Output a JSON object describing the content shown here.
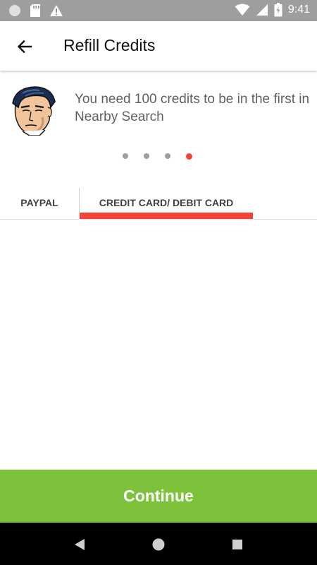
{
  "status_bar": {
    "time": "9:41",
    "icons": [
      "circle-icon",
      "sd-card-icon",
      "warning-icon",
      "wifi-icon",
      "signal-icon",
      "battery-icon"
    ]
  },
  "app_bar": {
    "title": "Refill Credits",
    "back_icon": "arrow-left-icon"
  },
  "banner": {
    "message": "You need 100 credits to be in the first in Nearby Search",
    "page_indicator": {
      "count": 4,
      "active_index": 3
    }
  },
  "tabs": [
    {
      "label": "PAYPAL",
      "selected": false
    },
    {
      "label": "CREDIT CARD/ DEBIT CARD",
      "selected": true
    }
  ],
  "footer": {
    "continue_label": "Continue"
  },
  "nav_bar": {
    "icons": [
      "back-triangle-icon",
      "home-circle-icon",
      "recents-square-icon"
    ]
  },
  "colors": {
    "accent": "#f44336",
    "continue_bg": "#7dc23b",
    "status_bar_bg": "#9e9e9e",
    "text_secondary": "#616161"
  }
}
